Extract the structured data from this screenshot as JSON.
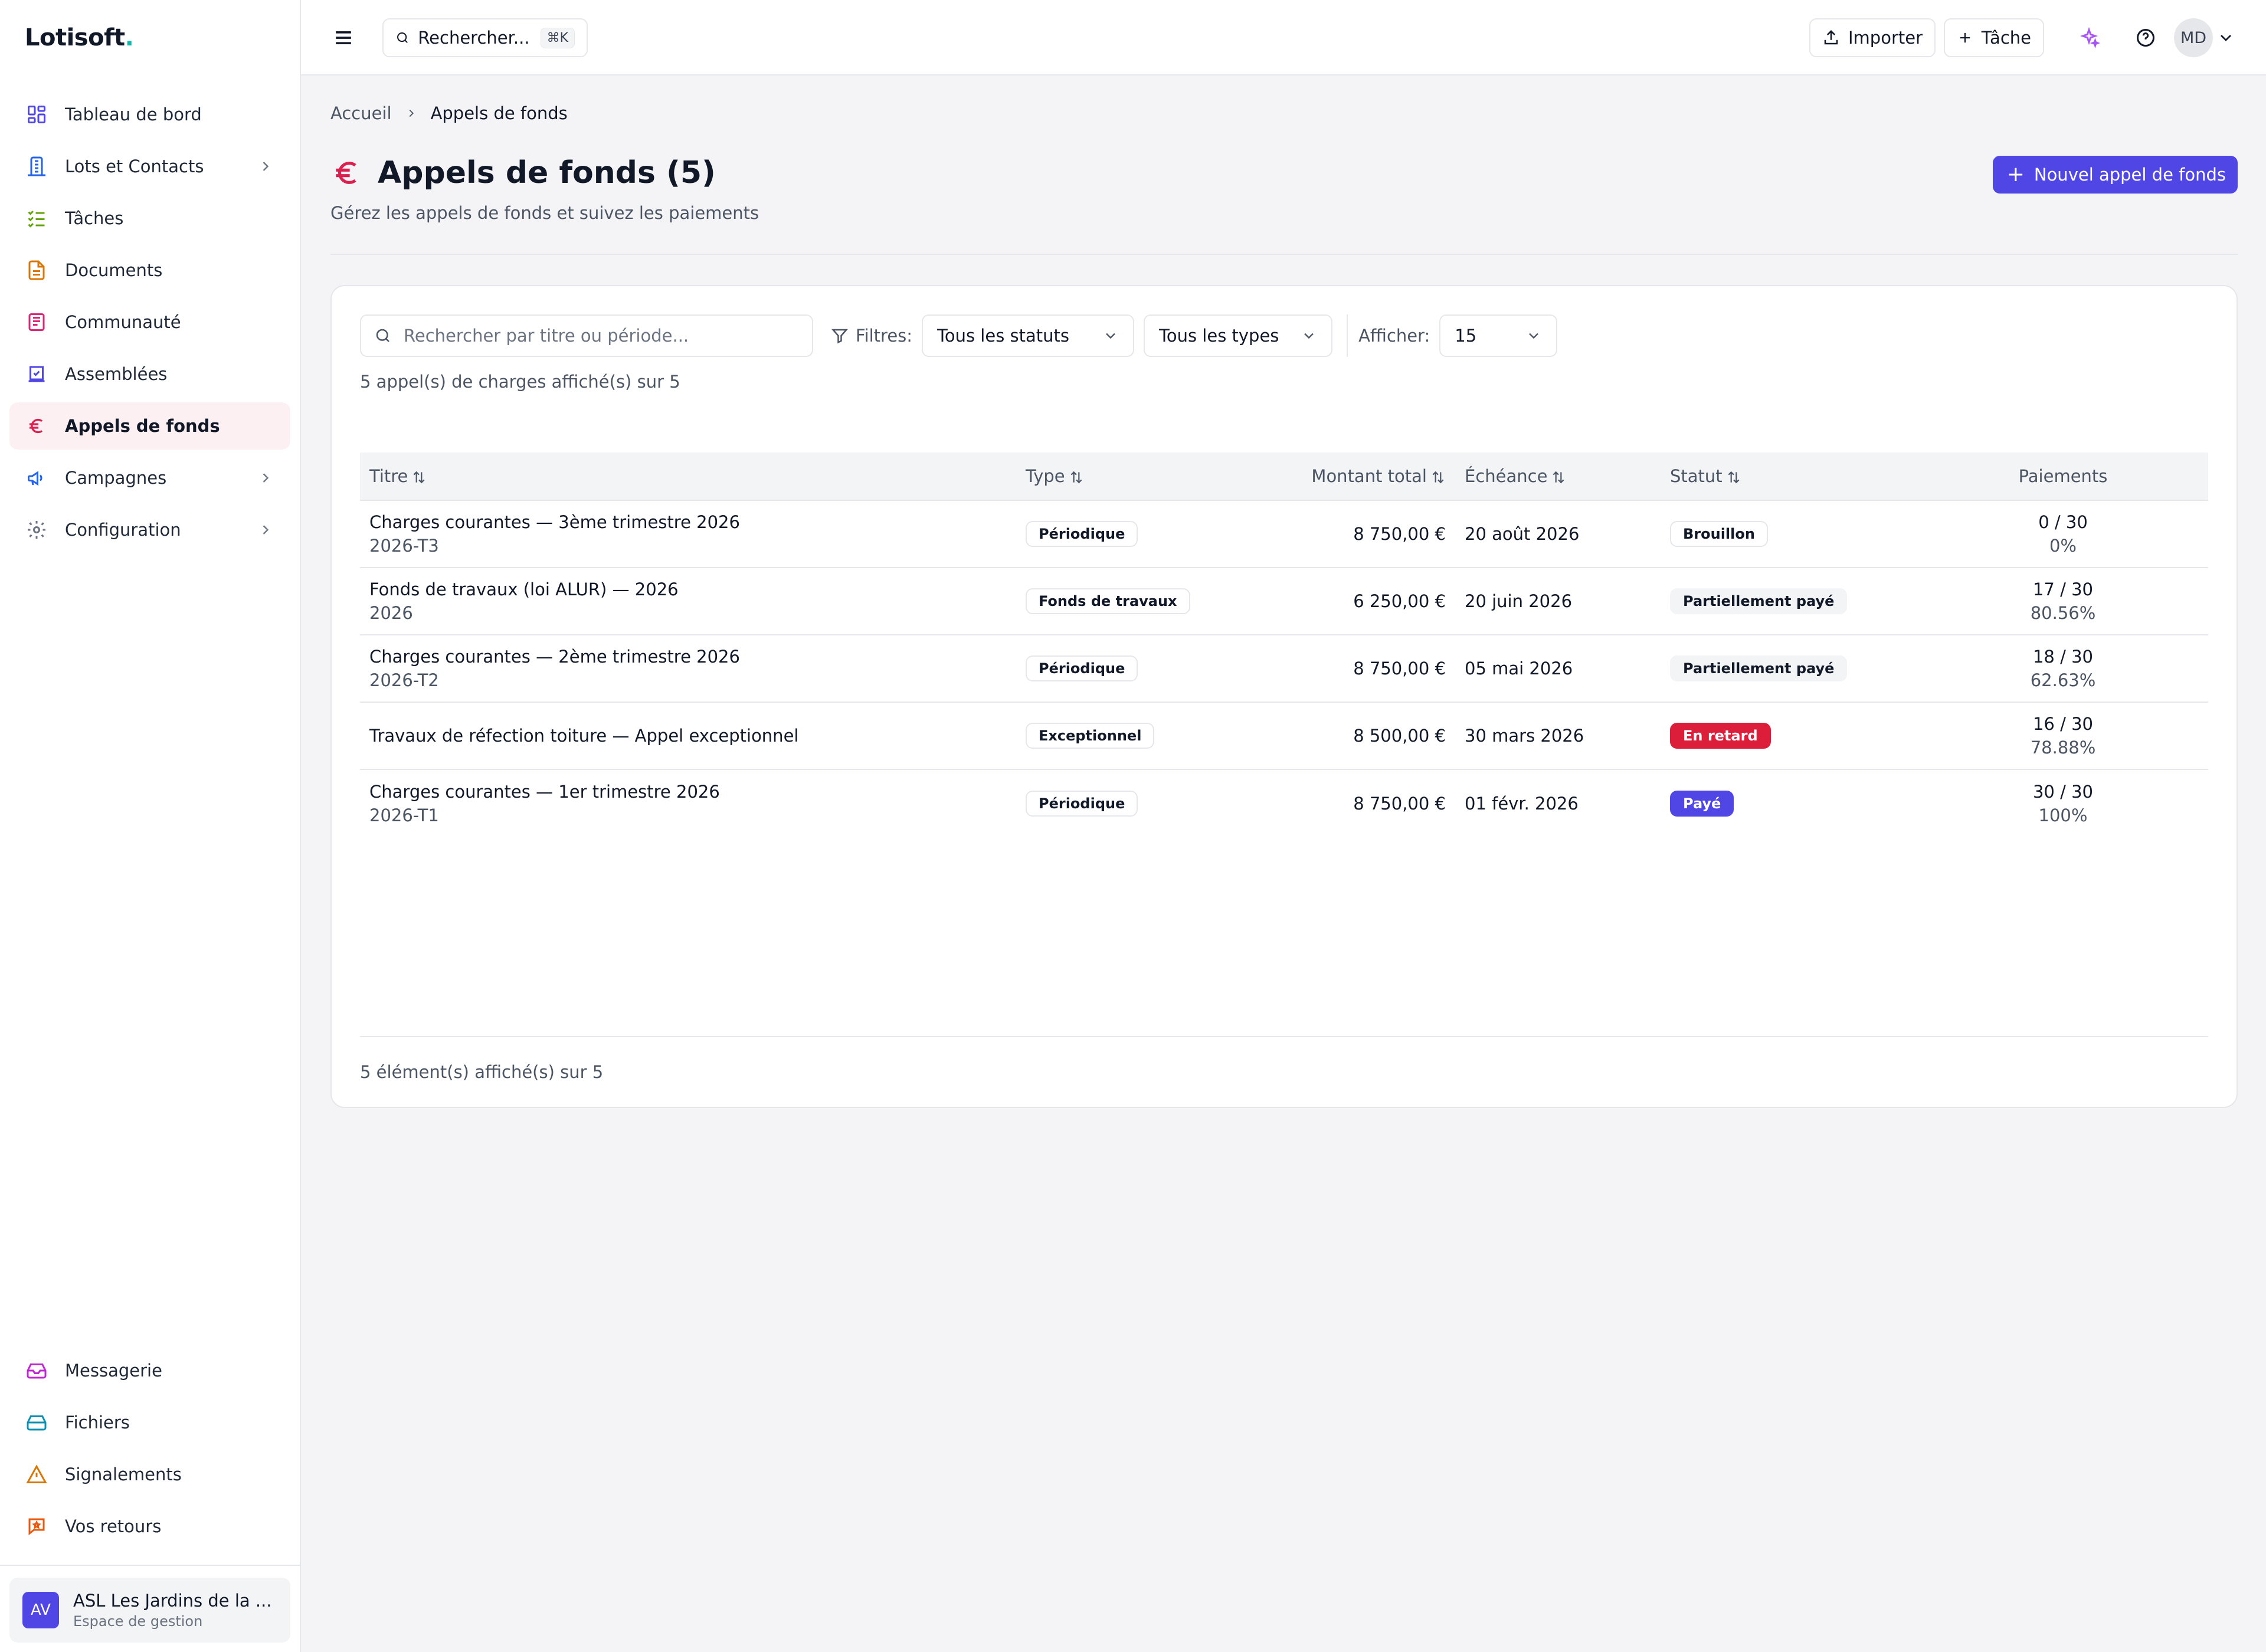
{
  "brand": {
    "name": "Lotisoft",
    "dot": "."
  },
  "sidebar": {
    "items": [
      {
        "label": "Tableau de bord",
        "icon": "dashboard-icon"
      },
      {
        "label": "Lots et Contacts",
        "icon": "building-icon"
      },
      {
        "label": "Tâches",
        "icon": "tasks-icon"
      },
      {
        "label": "Documents",
        "icon": "document-icon"
      },
      {
        "label": "Communauté",
        "icon": "newspaper-icon"
      },
      {
        "label": "Assemblées",
        "icon": "vote-icon"
      },
      {
        "label": "Appels de fonds",
        "icon": "euro-icon"
      },
      {
        "label": "Campagnes",
        "icon": "megaphone-icon"
      },
      {
        "label": "Configuration",
        "icon": "gear-icon"
      }
    ],
    "bottom_items": [
      {
        "label": "Messagerie",
        "icon": "inbox-icon"
      },
      {
        "label": "Fichiers",
        "icon": "drive-icon"
      },
      {
        "label": "Signalements",
        "icon": "warning-icon"
      },
      {
        "label": "Vos retours",
        "icon": "feedback-icon"
      }
    ],
    "org": {
      "initials": "AV",
      "name": "ASL Les Jardins de la ...",
      "subtitle": "Espace de gestion"
    }
  },
  "topbar": {
    "search_label": "Rechercher...",
    "shortcut": "⌘K",
    "import_label": "Importer",
    "task_label": "Tâche",
    "avatar_initials": "MD"
  },
  "breadcrumb": {
    "home": "Accueil",
    "current": "Appels de fonds"
  },
  "page": {
    "title": "Appels de fonds (5)",
    "subtitle": "Gérez les appels de fonds et suivez les paiements",
    "new_button": "Nouvel appel de fonds"
  },
  "filters": {
    "search_placeholder": "Rechercher par titre ou période...",
    "filters_label": "Filtres:",
    "status_value": "Tous les statuts",
    "type_value": "Tous les types",
    "show_label": "Afficher:",
    "show_value": "15",
    "count_text": "5 appel(s) de charges affiché(s) sur 5"
  },
  "table": {
    "headers": {
      "title": "Titre",
      "type": "Type",
      "amount": "Montant total",
      "due": "Échéance",
      "status": "Statut",
      "payments": "Paiements"
    },
    "rows": [
      {
        "title": "Charges courantes — 3ème trimestre 2026",
        "period": "2026-T3",
        "type": "Périodique",
        "amount": "8 750,00 €",
        "due": "20 août 2026",
        "status": "Brouillon",
        "status_kind": "draft",
        "payments": "0 / 30",
        "percent": "0%"
      },
      {
        "title": "Fonds de travaux (loi ALUR) — 2026",
        "period": "2026",
        "type": "Fonds de travaux",
        "amount": "6 250,00 €",
        "due": "20 juin 2026",
        "status": "Partiellement payé",
        "status_kind": "partial",
        "payments": "17 / 30",
        "percent": "80.56%"
      },
      {
        "title": "Charges courantes — 2ème trimestre 2026",
        "period": "2026-T2",
        "type": "Périodique",
        "amount": "8 750,00 €",
        "due": "05 mai 2026",
        "status": "Partiellement payé",
        "status_kind": "partial",
        "payments": "18 / 30",
        "percent": "62.63%"
      },
      {
        "title": "Travaux de réfection toiture — Appel exceptionnel",
        "period": "",
        "type": "Exceptionnel",
        "amount": "8 500,00 €",
        "due": "30 mars 2026",
        "status": "En retard",
        "status_kind": "late",
        "payments": "16 / 30",
        "percent": "78.88%"
      },
      {
        "title": "Charges courantes — 1er trimestre 2026",
        "period": "2026-T1",
        "type": "Périodique",
        "amount": "8 750,00 €",
        "due": "01 févr. 2026",
        "status": "Payé",
        "status_kind": "paid",
        "payments": "30 / 30",
        "percent": "100%"
      }
    ],
    "footer": "5 élément(s) affiché(s) sur 5"
  },
  "colors": {
    "accent": "#4f46e5",
    "euro": "#db2050",
    "late": "#dc1e3a",
    "active_bg": "#fdf0f2"
  }
}
